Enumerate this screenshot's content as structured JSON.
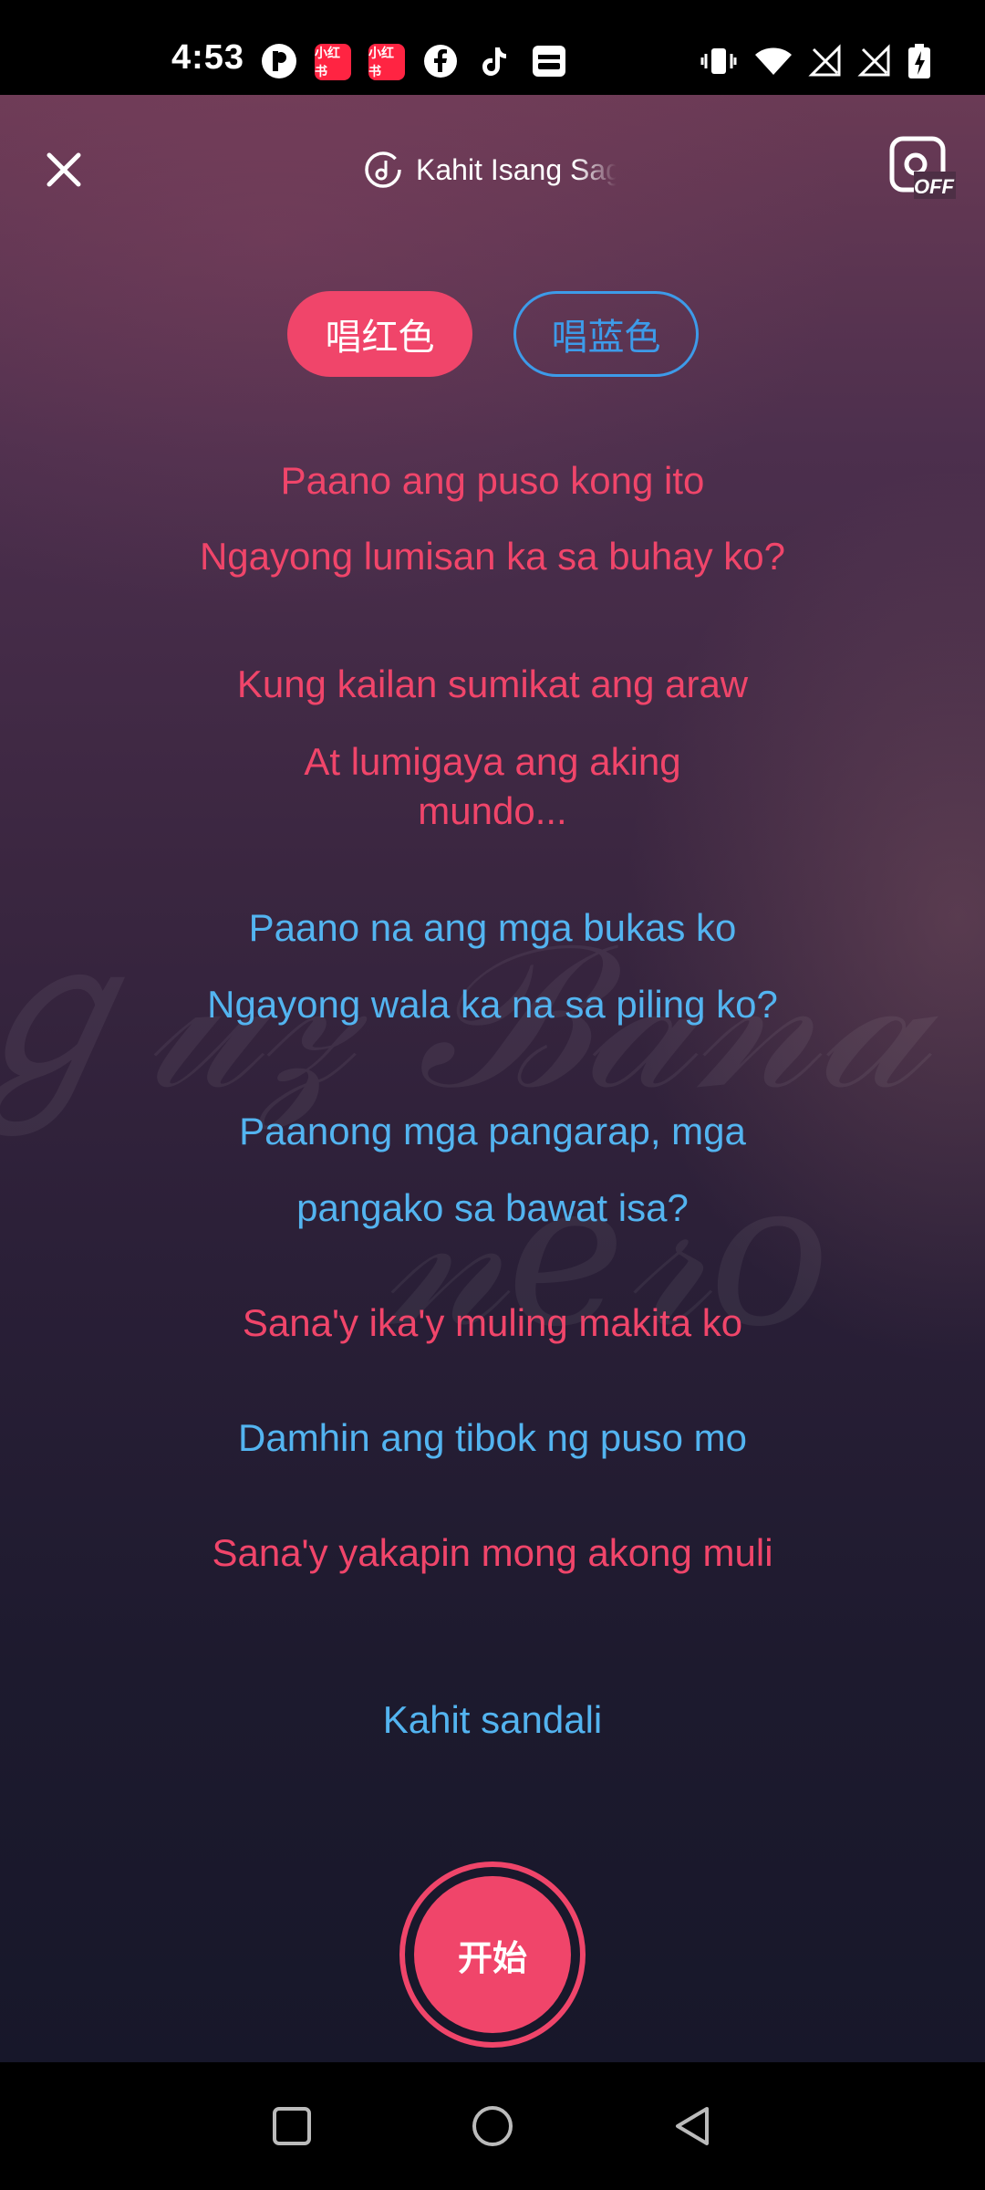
{
  "status_bar": {
    "time": "4:53",
    "left_icons": [
      "p-app-icon",
      "xiaohongshu-icon",
      "xiaohongshu-icon",
      "facebook-icon",
      "tiktok-icon",
      "wallet-icon"
    ],
    "app_badge_text": "小红书",
    "right_icons": [
      "vibrate-icon",
      "wifi-icon",
      "no-signal-icon",
      "no-signal-icon",
      "battery-charging-icon"
    ]
  },
  "header": {
    "song_title": "Kahit Isang Saglit",
    "camera_badge": "OFF"
  },
  "parts": {
    "red_label": "唱红色",
    "blue_label": "唱蓝色",
    "red_color": "#f0456a",
    "blue_color": "#3d9be9"
  },
  "lyrics": [
    {
      "text": "Paano ang puso kong ito",
      "part": "red"
    },
    {
      "text": "Ngayong lumisan ka sa buhay ko?",
      "part": "red"
    },
    {
      "text": "Kung kailan sumikat ang araw",
      "part": "red"
    },
    {
      "text": "At lumigaya ang aking mundo...",
      "part": "red"
    },
    {
      "text": "Paano na ang mga bukas ko",
      "part": "blue"
    },
    {
      "text": "Ngayong wala ka na sa piling ko?",
      "part": "blue"
    },
    {
      "text": "Paanong mga pangarap, mga",
      "part": "blue"
    },
    {
      "text": "pangako sa bawat isa?",
      "part": "blue"
    },
    {
      "text": "Sana'y ika'y muling makita ko",
      "part": "red"
    },
    {
      "text": "Damhin ang tibok ng puso mo",
      "part": "blue"
    },
    {
      "text": "Sana'y yakapin mong akong muli",
      "part": "red"
    },
    {
      "text": "Kahit sandali",
      "part": "blue"
    }
  ],
  "start_button": {
    "label": "开始"
  },
  "nav": {
    "icons": [
      "recents-square-icon",
      "home-circle-icon",
      "back-triangle-icon"
    ]
  }
}
